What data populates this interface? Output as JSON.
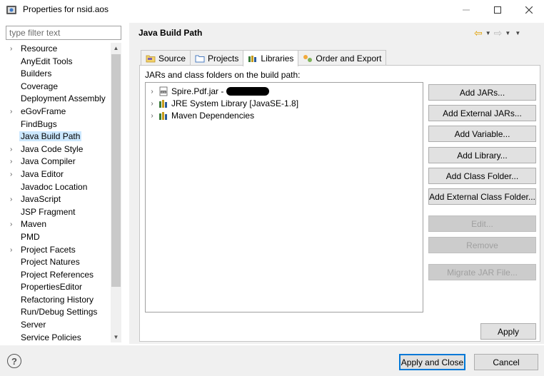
{
  "window": {
    "title": "Properties for nsid.aos"
  },
  "filter": {
    "placeholder": "type filter text"
  },
  "nav": {
    "items": [
      {
        "label": "Resource",
        "expandable": true
      },
      {
        "label": "AnyEdit Tools",
        "expandable": false
      },
      {
        "label": "Builders",
        "expandable": false
      },
      {
        "label": "Coverage",
        "expandable": false
      },
      {
        "label": "Deployment Assembly",
        "expandable": false
      },
      {
        "label": "eGovFrame",
        "expandable": true
      },
      {
        "label": "FindBugs",
        "expandable": false
      },
      {
        "label": "Java Build Path",
        "expandable": false,
        "selected": true
      },
      {
        "label": "Java Code Style",
        "expandable": true
      },
      {
        "label": "Java Compiler",
        "expandable": true
      },
      {
        "label": "Java Editor",
        "expandable": true
      },
      {
        "label": "Javadoc Location",
        "expandable": false
      },
      {
        "label": "JavaScript",
        "expandable": true
      },
      {
        "label": "JSP Fragment",
        "expandable": false
      },
      {
        "label": "Maven",
        "expandable": true
      },
      {
        "label": "PMD",
        "expandable": false
      },
      {
        "label": "Project Facets",
        "expandable": true
      },
      {
        "label": "Project Natures",
        "expandable": false
      },
      {
        "label": "Project References",
        "expandable": false
      },
      {
        "label": "PropertiesEditor",
        "expandable": false
      },
      {
        "label": "Refactoring History",
        "expandable": false
      },
      {
        "label": "Run/Debug Settings",
        "expandable": false
      },
      {
        "label": "Server",
        "expandable": false
      },
      {
        "label": "Service Policies",
        "expandable": false
      }
    ]
  },
  "page": {
    "title": "Java Build Path"
  },
  "tabs": [
    {
      "label": "Source",
      "icon": "source-folder-icon"
    },
    {
      "label": "Projects",
      "icon": "projects-icon"
    },
    {
      "label": "Libraries",
      "icon": "libraries-icon",
      "active": true
    },
    {
      "label": "Order and Export",
      "icon": "order-export-icon"
    }
  ],
  "libraries": {
    "label": "JARs and class folders on the build path:",
    "tree": [
      {
        "label": "Spire.Pdf.jar -",
        "icon": "jar-icon",
        "redacted": true
      },
      {
        "label": "JRE System Library [JavaSE-1.8]",
        "icon": "library-icon"
      },
      {
        "label": "Maven Dependencies",
        "icon": "library-icon"
      }
    ]
  },
  "buttons": {
    "add_jars": "Add JARs...",
    "add_external_jars": "Add External JARs...",
    "add_variable": "Add Variable...",
    "add_library": "Add Library...",
    "add_class_folder": "Add Class Folder...",
    "add_external_class_folder": "Add External Class Folder...",
    "edit": "Edit...",
    "remove": "Remove",
    "migrate_jar": "Migrate JAR File...",
    "apply": "Apply",
    "apply_and_close": "Apply and Close",
    "cancel": "Cancel"
  },
  "help": {
    "symbol": "?"
  },
  "colors": {
    "selection": "#cce8ff",
    "panel_bg": "#f0f0f0",
    "button_bg": "#e1e1e1"
  }
}
